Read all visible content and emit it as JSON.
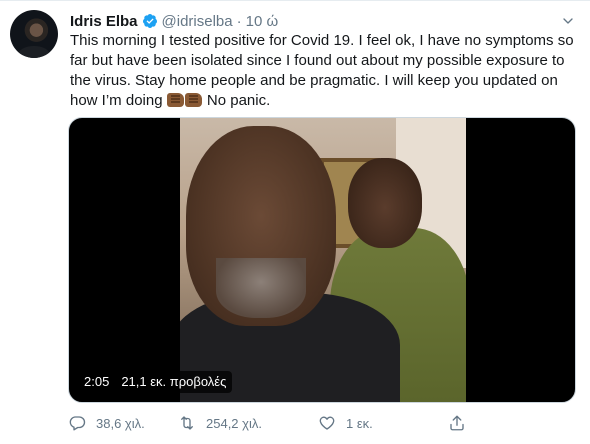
{
  "tweet": {
    "author_name": "Idris Elba",
    "handle": "@idriselba",
    "separator": "·",
    "time": "10 ώ",
    "text_main": "This morning I tested positive for Covid 19. I feel ok, I have no symptoms so far but have been isolated since I found out about my possible exposure to the virus.  Stay home people and be pragmatic. I will keep you updated on how I’m doing ",
    "text_end": " No panic.",
    "video": {
      "duration": "2:05",
      "views": "21,1 εκ. προβολές"
    },
    "actions": {
      "reply_count": "38,6 χιλ.",
      "retweet_count": "254,2 χιλ.",
      "like_count": "1 εκ."
    }
  },
  "colors": {
    "accent": "#1da1f2",
    "text": "#14171a",
    "muted": "#657786"
  },
  "icons": [
    "verified-badge-icon",
    "chevron-down-icon",
    "reply-icon",
    "retweet-icon",
    "like-icon",
    "share-icon",
    "fist-bump-emoji"
  ]
}
